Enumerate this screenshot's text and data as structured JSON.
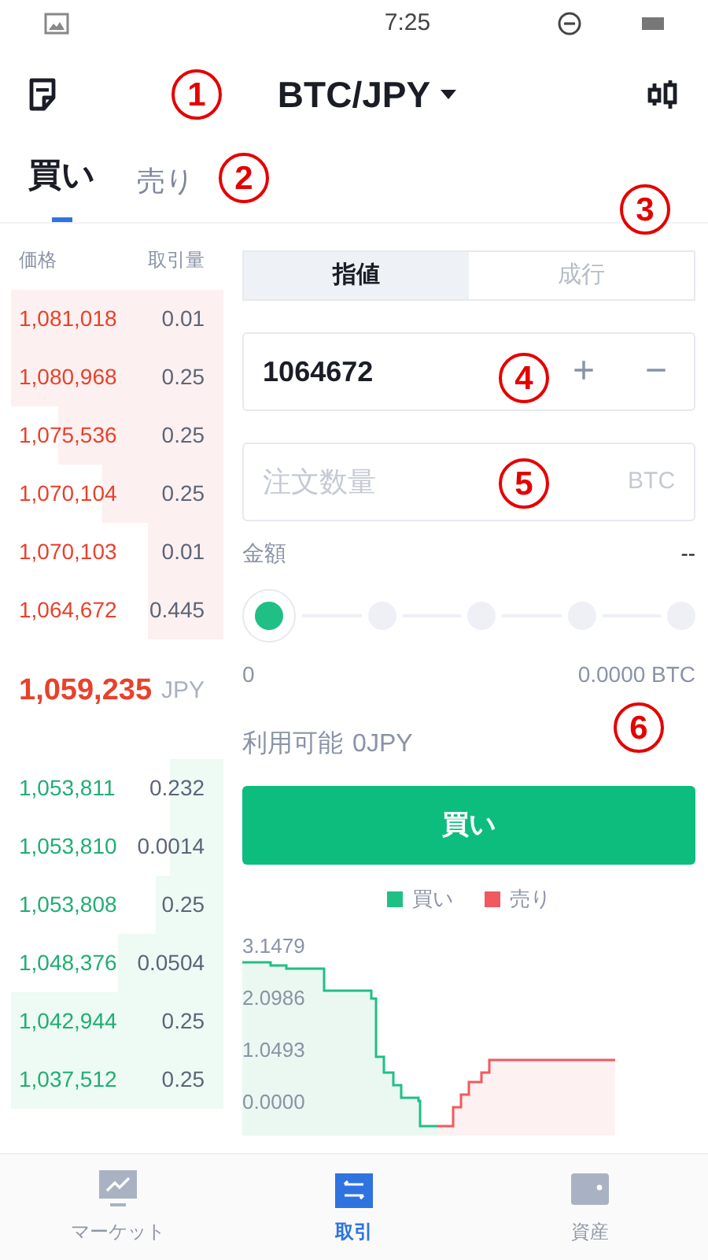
{
  "status_bar": {
    "time": "7:25"
  },
  "header": {
    "pair": "BTC/JPY"
  },
  "tabs": [
    {
      "label": "買い",
      "selected": true
    },
    {
      "label": "売り",
      "selected": false
    }
  ],
  "order_book": {
    "columns": [
      "価格",
      "取引量"
    ],
    "asks": [
      {
        "price": "1,081,018",
        "amount": "0.01"
      },
      {
        "price": "1,080,968",
        "amount": "0.25"
      },
      {
        "price": "1,075,536",
        "amount": "0.25"
      },
      {
        "price": "1,070,104",
        "amount": "0.25"
      },
      {
        "price": "1,070,103",
        "amount": "0.01"
      },
      {
        "price": "1,064,672",
        "amount": "0.445"
      }
    ],
    "last_price": "1,059,235",
    "last_currency": "JPY",
    "bids": [
      {
        "price": "1,053,811",
        "amount": "0.232"
      },
      {
        "price": "1,053,810",
        "amount": "0.0014"
      },
      {
        "price": "1,053,808",
        "amount": "0.25"
      },
      {
        "price": "1,048,376",
        "amount": "0.0504"
      },
      {
        "price": "1,042,944",
        "amount": "0.25"
      },
      {
        "price": "1,037,512",
        "amount": "0.25"
      }
    ]
  },
  "order_types": [
    {
      "label": "指値",
      "selected": true
    },
    {
      "label": "成行",
      "selected": false
    }
  ],
  "price_field": {
    "value": "1064672",
    "plus": "+",
    "minus": "−"
  },
  "quantity_field": {
    "placeholder": "注文数量",
    "unit": "BTC"
  },
  "amount": {
    "label": "金額",
    "value": "--"
  },
  "slider": {
    "min_label": "0",
    "max_label": "0.0000 BTC"
  },
  "available": {
    "label": "利用可能",
    "value": "0JPY"
  },
  "submit_button": "買い",
  "depth_chart": {
    "legend": [
      {
        "label": "買い",
        "color": "#1fbf85"
      },
      {
        "label": "売り",
        "color": "#f0595f"
      }
    ],
    "y_labels": [
      "3.1479",
      "2.0986",
      "1.0493",
      "0.0000"
    ]
  },
  "bottom_nav": [
    {
      "label": "マーケット",
      "selected": false
    },
    {
      "label": "取引",
      "selected": true
    },
    {
      "label": "資産",
      "selected": false
    }
  ],
  "annotations": [
    {
      "label": "1"
    },
    {
      "label": "2"
    },
    {
      "label": "3"
    },
    {
      "label": "4"
    },
    {
      "label": "5"
    },
    {
      "label": "6"
    }
  ]
}
